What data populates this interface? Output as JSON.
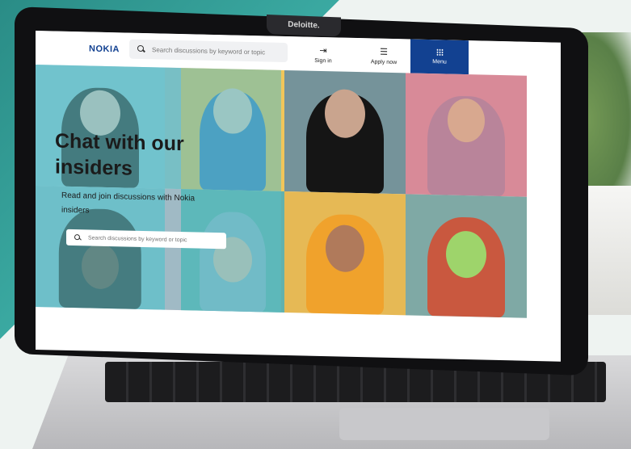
{
  "brand": {
    "logo_text": "NOKIA",
    "color": "#124191"
  },
  "laptop": {
    "camera_label": "Deloitte."
  },
  "header": {
    "search_placeholder": "Search discussions by keyword or topic",
    "nav": [
      {
        "label": "Sign in",
        "icon": "sign-in-icon"
      },
      {
        "label": "Apply now",
        "icon": "form-icon"
      },
      {
        "label": "Menu",
        "icon": "grid-menu-icon"
      }
    ]
  },
  "hero": {
    "title": "Chat with our insiders",
    "subtitle": "Read and join discussions with Nokia insiders",
    "search_placeholder": "Search discussions by keyword or topic",
    "overlay_color": "#59bec4"
  }
}
